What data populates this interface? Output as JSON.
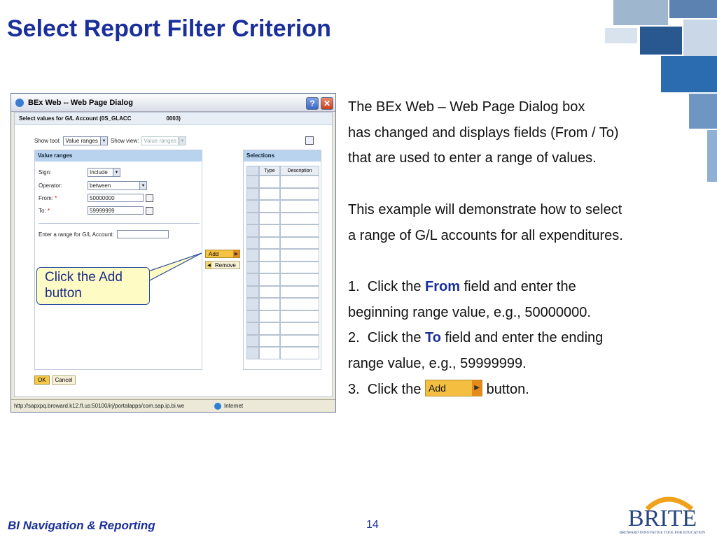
{
  "slide": {
    "title": "Select Report Filter Criterion",
    "footer_left": "BI Navigation & Reporting",
    "page_number": "14"
  },
  "dialog": {
    "window_title": "BEx Web -- Web Page Dialog",
    "header_label": "Select values for G/L Account (0S_GLACC",
    "header_code": "0003)",
    "show_tool_label": "Show tool:",
    "show_tool_value": "Value ranges",
    "show_view_label": "Show view:",
    "show_view_value": "Value ranges",
    "value_ranges_title": "Value ranges",
    "sign_label": "Sign:",
    "sign_value": "Include",
    "operator_label": "Operator:",
    "operator_value": "between",
    "from_label": "From:",
    "from_value": "50000000",
    "to_label": "To:",
    "to_value": "59999999",
    "required_mark": "*",
    "range_label": "Enter a range for G/L Account:",
    "selections_title": "Selections",
    "col_type": "Type",
    "col_description": "Description",
    "add_label": "Add",
    "remove_label": "Remove",
    "ok_label": "OK",
    "cancel_label": "Cancel",
    "status_url": "http://sapxpq.broward.k12.fl.us:50100/irj/portalapps/com.sap.ip.bi.we",
    "status_zone": "Internet"
  },
  "callout": {
    "text": "Click the Add button"
  },
  "description": {
    "p1_l1": "The BEx Web – Web Page Dialog box",
    "p1_l2": "has changed and displays fields (From / To)",
    "p1_l3": "that are used to enter a range of values.",
    "p2_l1": "This example will demonstrate how to select",
    "p2_l2": "a range of G/L accounts for all expenditures.",
    "s1_pre": "1.  Click the ",
    "s1_kw": "From",
    "s1_post": " field and enter the",
    "s1_l2": "beginning range value, e.g., 50000000.",
    "s2_pre": "2.  Click the ",
    "s2_kw": "To",
    "s2_post": " field and enter the ending",
    "s2_l2": "range value, e.g., 59999999.",
    "s3_pre": "3.  Click the ",
    "s3_button": "Add",
    "s3_post": " button."
  },
  "logo": {
    "name": "BRITE",
    "tagline": "BROWARD INNOVATIVE TOOL FOR EDUCATION"
  },
  "colors": {
    "title_blue": "#1a2f9a",
    "add_orange": "#f4bf40",
    "callout_fill": "#fffbc4"
  },
  "icons": [
    "help-icon",
    "close-icon",
    "ie-icon",
    "dropdown-arrow-icon",
    "calendar-icon",
    "properties-icon",
    "globe-icon",
    "arrow-right-icon",
    "arrow-left-icon"
  ]
}
